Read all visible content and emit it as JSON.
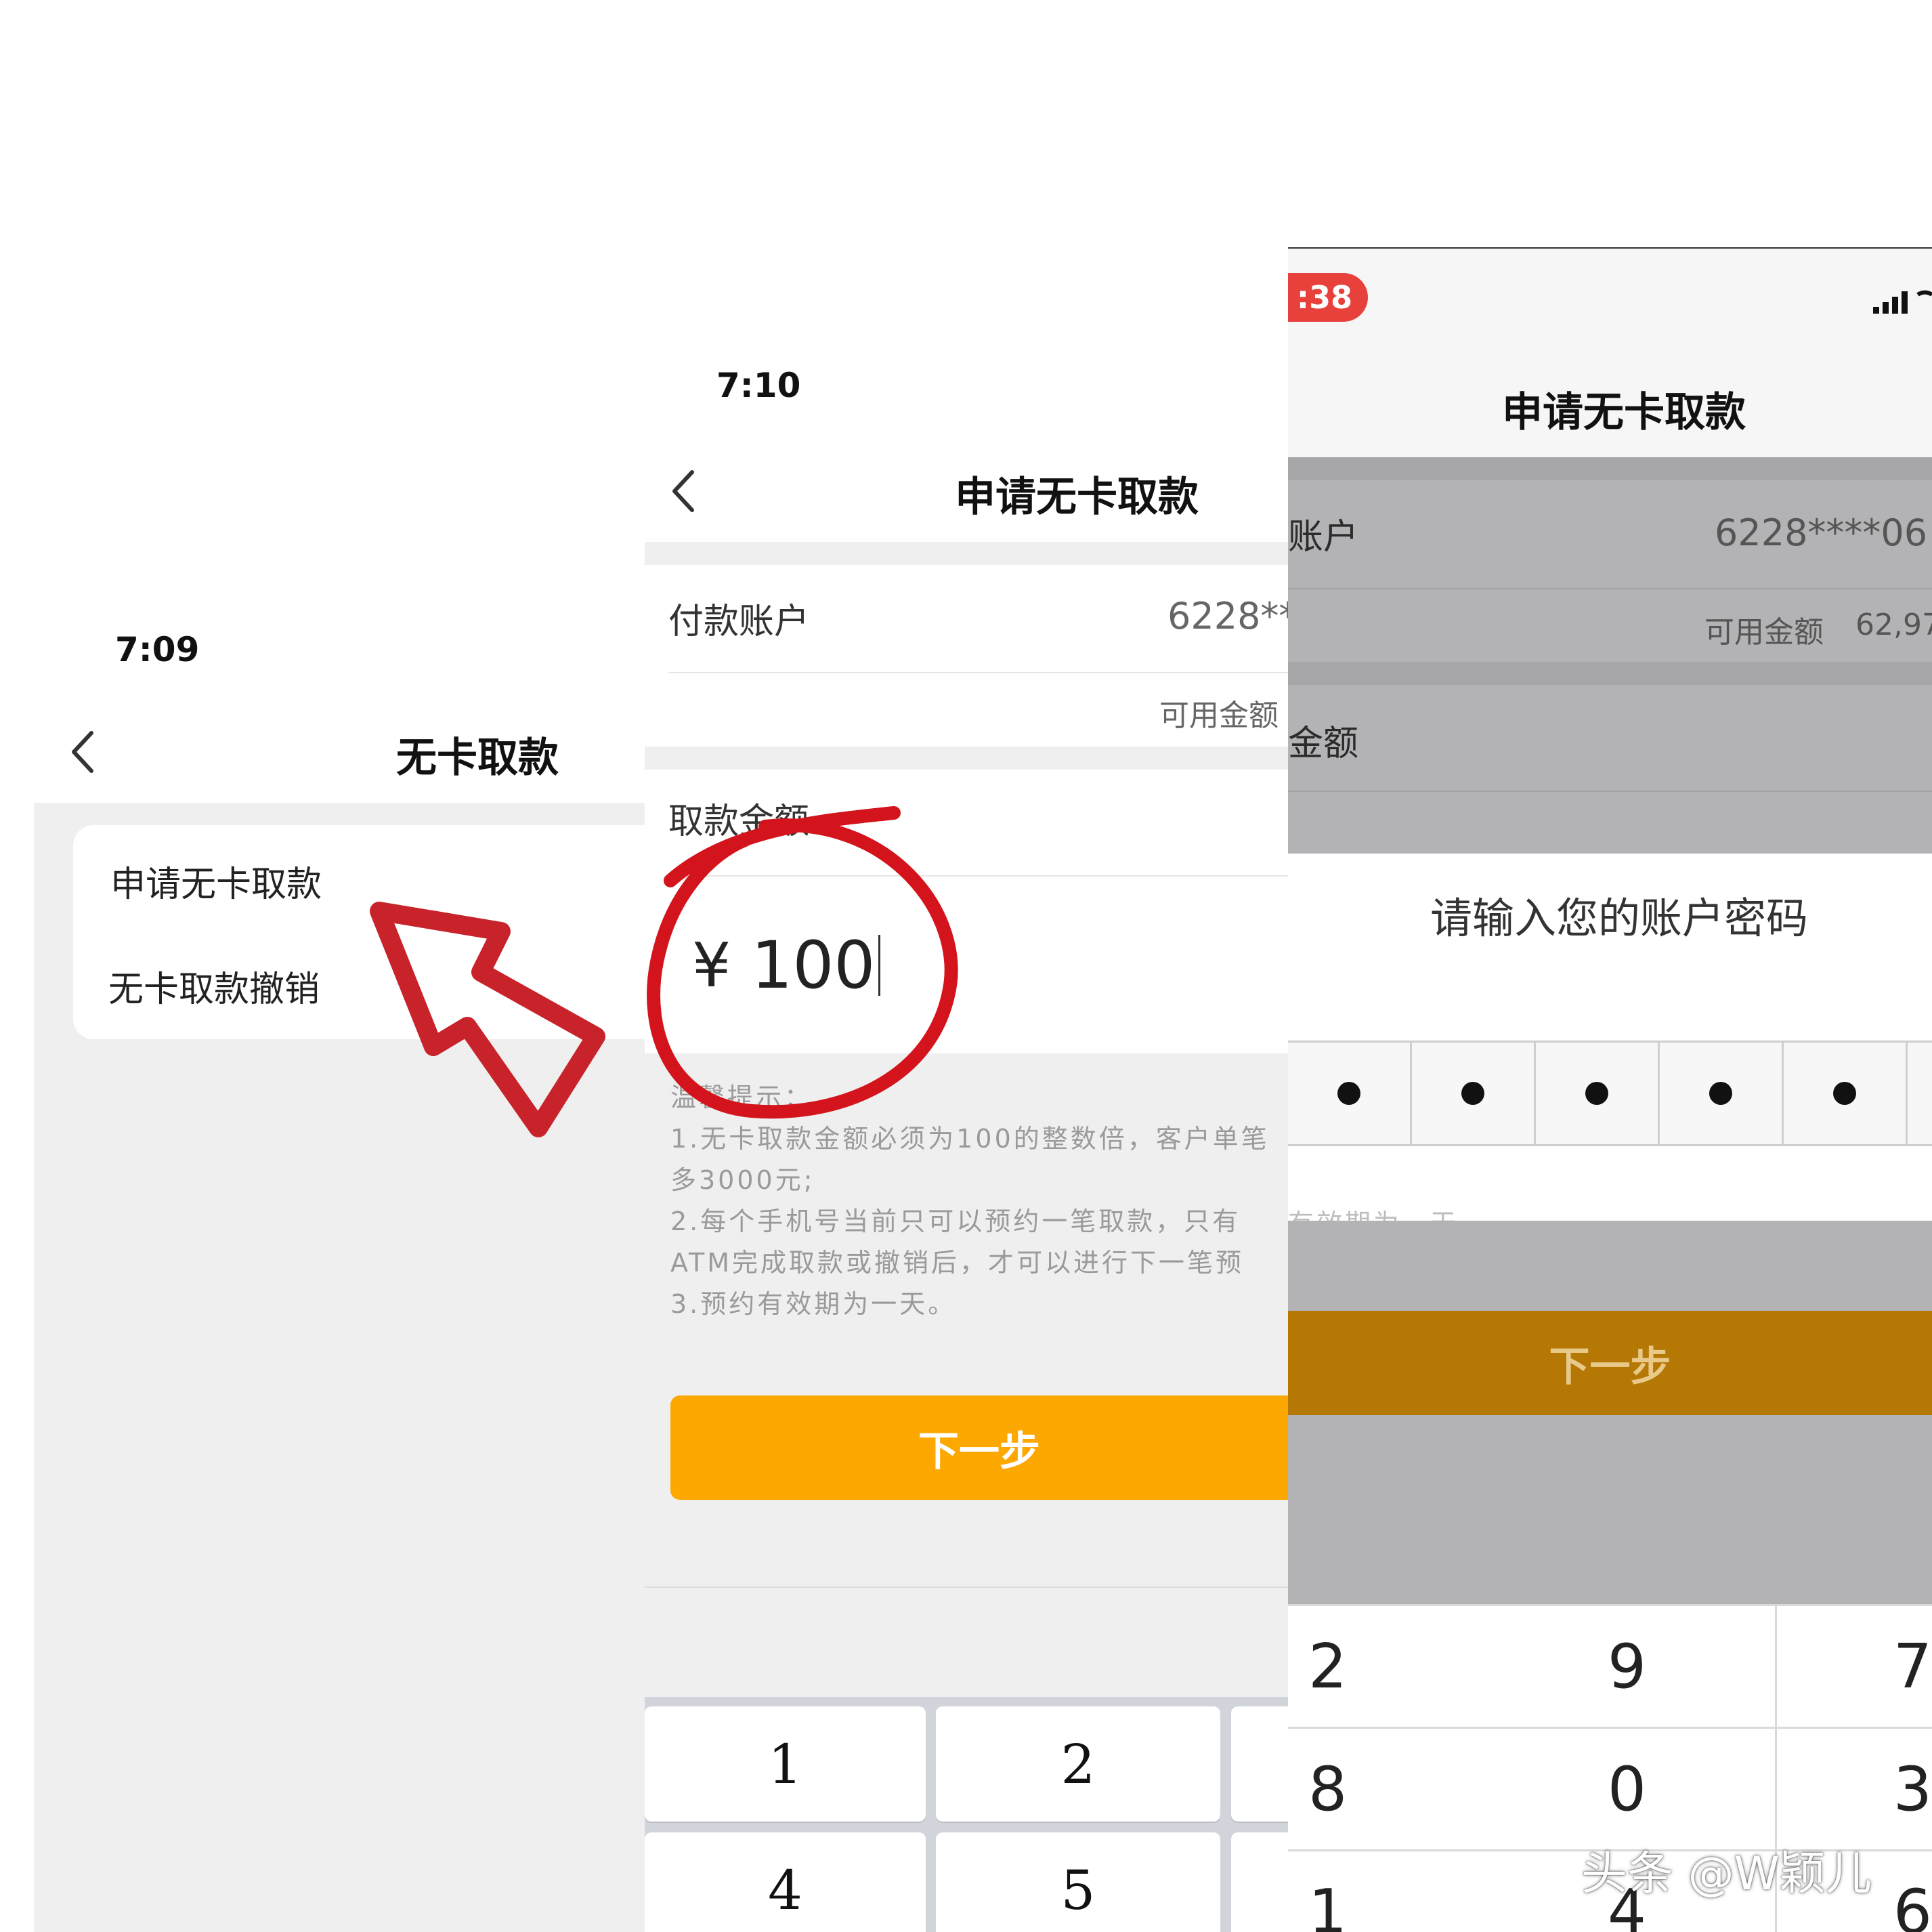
{
  "panel1": {
    "time": "7:09",
    "back_icon": "chevron-left-icon",
    "title": "无卡取款",
    "menu": [
      {
        "label": "申请无卡取款"
      },
      {
        "label": "无卡取款撤销"
      }
    ],
    "annotation": "red-arrow-icon"
  },
  "panel2": {
    "time": "7:10",
    "back_icon": "chevron-left-icon",
    "title": "申请无卡取款",
    "account_label": "付款账户",
    "account_value": "6228**",
    "available_label": "可用金额",
    "amount_label": "取款金额",
    "currency": "¥",
    "amount": "100",
    "tips": [
      "温馨提示：",
      "1.无卡取款金额必须为100的整数倍，客户单笔",
      "多3000元;",
      "2.每个手机号当前只可以预约一笔取款，只有",
      "ATM完成取款或撤销后，才可以进行下一笔预",
      "3.预约有效期为一天。"
    ],
    "next_button": "下一步",
    "keypad": [
      "1",
      "2",
      "4",
      "5"
    ],
    "annotation": "red-circle-icon"
  },
  "panel3": {
    "time": ":38",
    "signal_icon": "signal-bars-icon",
    "title": "申请无卡取款",
    "account_label": "账户",
    "account_value": "6228****06",
    "available_label": "可用金额",
    "available_value": "62,97",
    "amount_label": "金额",
    "overflow_text": "有效期为一天。",
    "password_prompt": "请输入您的账户密码",
    "next_button": "下一步",
    "keypad": [
      "2",
      "9",
      "7",
      "8",
      "0",
      "3",
      "1",
      "4",
      "6"
    ]
  },
  "watermark": "头条 @W颖儿",
  "colors": {
    "accent": "#FCA800",
    "accent_dim": "#B57805",
    "annotation_red": "#C8222A",
    "badge_red": "#E8403A",
    "overlay_grey": "#B3B2B5"
  }
}
